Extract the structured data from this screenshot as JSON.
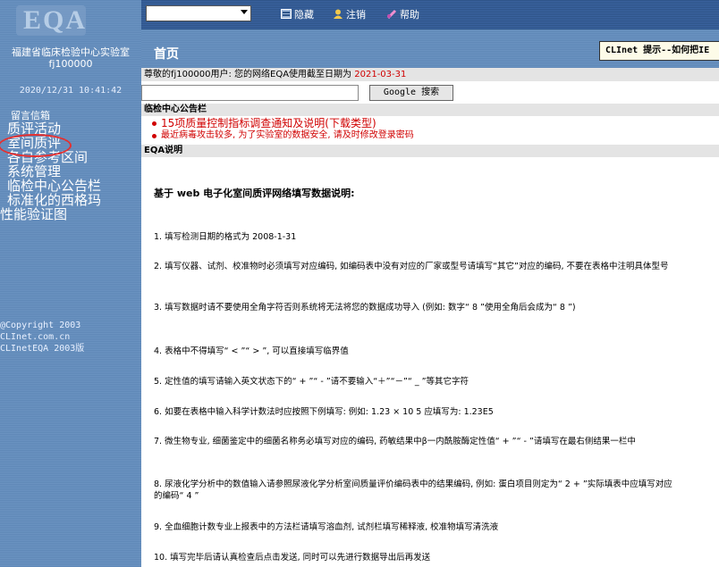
{
  "logo": {
    "text": "EQA"
  },
  "sidebar": {
    "org_name": "福建省临床检验中心实验室",
    "user_code": "fj100000",
    "datetime": "2020/12/31 10:41:42",
    "menu": [
      "留言信箱",
      "质评活动",
      "室间质评",
      "各自参考区间",
      "系统管理",
      "临检中心公告栏",
      "标准化的西格玛",
      "性能验证图"
    ],
    "copyright": [
      "@Copyright 2003",
      "CLInet.com.cn",
      "CLInetEQA 2003版"
    ]
  },
  "topbar": {
    "select_value": "",
    "hide": "隐藏",
    "logout": "注销",
    "help": "帮助"
  },
  "main": {
    "page_title": "首页",
    "tip": "CLInet 提示--如何把IE",
    "welcome_prefix": "尊敬的fj100000用户: 您的网络EQA使用截至日期为",
    "expire_date": "2021-03-31",
    "search_button": "Google 搜索",
    "bulletin_header": "临检中心公告栏",
    "notices": [
      "15项质量控制指标调查通知及说明(下载类型)",
      "最近病毒攻击较多, 为了实验室的数据安全, 请及时修改登录密码"
    ],
    "eqa_header": "EQA说明",
    "doc_title": "基于 web 电子化室间质评网络填写数据说明:",
    "doc_items": [
      "1.  填写检测日期的格式为 2008-1-31",
      "2.  填写仪器、试剂、校准物时必须填写对应编码, 如编码表中没有对应的厂家或型号请填写“其它”对应的编码, 不要在表格中注明具体型号",
      "3.  填写数据时请不要使用全角字符否则系统将无法将您的数据成功导入 (例如: 数字“ 8 ”使用全角后会成为“ 8 ”)",
      "4.  表格中不得填写“ < ”“ > ”, 可以直接填写临界值",
      "5.  定性值的填写请输入英文状态下的“ + ”“ - ”请不要输入“＋”“－”“ _ ”等其它字符",
      "6.  如要在表格中输入科学计数法时应按照下例填写: 例如:  1.23 × 10 5 应填写为:  1.23E5",
      "7.  微生物专业, 细菌鉴定中的细菌名称务必填写对应的编码, 药敏结果中β一内酰胺酶定性值“ + ”“ - ”请填写在最右侧结果一栏中",
      "8.  尿液化学分析中的数值输入请参照尿液化学分析室间质量评价编码表中的结果编码, 例如: 蛋白项目则定为“ 2 + ”实际填表中应填写对应的编码“ 4 ”",
      "9.  全血细胞计数专业上报表中的方法栏请填写溶血剂, 试剂栏填写稀释液, 校准物填写清洗液",
      "10.  填写完毕后请认真检查后点击发送, 同时可以先进行数据导出后再发送"
    ]
  },
  "colors": {
    "sidebar": "#6b93c1",
    "topbar": "#3b63a0",
    "notice_red": "#d00000",
    "highlight_circle": "#e53030"
  }
}
